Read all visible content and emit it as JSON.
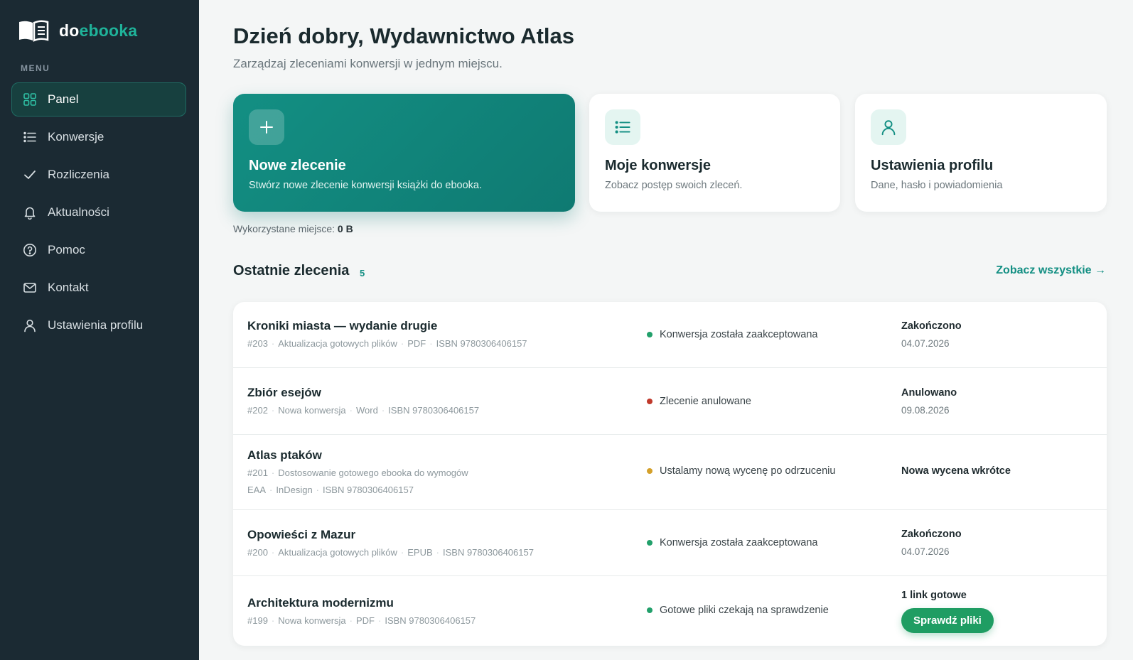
{
  "brand": {
    "name_part1": "do",
    "name_part2": "ebooka"
  },
  "sidebar": {
    "menu_heading": "MENU",
    "items": [
      {
        "label": "Panel",
        "icon": "grid-icon",
        "active": true
      },
      {
        "label": "Konwersje",
        "icon": "list-icon"
      },
      {
        "label": "Rozliczenia",
        "icon": "check-icon"
      },
      {
        "label": "Aktualności",
        "icon": "bell-icon"
      },
      {
        "label": "Pomoc",
        "icon": "help-circle-icon"
      },
      {
        "label": "Kontakt",
        "icon": "mail-icon"
      },
      {
        "label": "Ustawienia profilu",
        "icon": "user-icon"
      }
    ]
  },
  "header": {
    "greeting": "Dzień dobry, Wydawnictwo Atlas",
    "subtitle": "Zarządzaj zleceniami konwersji w jednym miejscu."
  },
  "cards": [
    {
      "title": "Nowe zlecenie",
      "desc": "Stwórz nowe zlecenie konwersji książki do ebooka.",
      "icon": "plus-icon"
    },
    {
      "title": "Moje konwersje",
      "desc": "Zobacz postęp swoich zleceń.",
      "icon": "list-icon"
    },
    {
      "title": "Ustawienia profilu",
      "desc": "Dane, hasło i powiadomienia",
      "icon": "user-icon"
    }
  ],
  "storage": {
    "label": "Wykorzystane miejsce:",
    "value": "0 B"
  },
  "recent": {
    "title": "Ostatnie zlecenia",
    "count": "5",
    "see_all": "Zobacz wszystkie →",
    "orders": [
      {
        "title": "Kroniki miasta — wydanie drugie",
        "id": "#203",
        "type": "Aktualizacja gotowych plików",
        "format": "PDF",
        "isbn": "ISBN 9780306406157",
        "status": "Konwersja została zaakceptowana",
        "status_color": "#22a06b",
        "right_label": "Zakończono",
        "right_date": "04.07.2026"
      },
      {
        "title": "Zbiór esejów",
        "id": "#202",
        "type": "Nowa konwersja",
        "format": "Word",
        "isbn": "ISBN 9780306406157",
        "status": "Zlecenie anulowane",
        "status_color": "#c0392b",
        "right_label": "Anulowano",
        "right_date": "09.08.2026"
      },
      {
        "title": "Atlas ptaków",
        "id": "#201",
        "type": "Dostosowanie gotowego ebooka do wymogów EAA",
        "format": "InDesign",
        "isbn": "ISBN 9780306406157",
        "status": "Ustalamy nową wycenę po odrzuceniu",
        "status_color": "#d4a02a",
        "right_label": "Nowa wycena wkrótce"
      },
      {
        "title": "Opowieści z Mazur",
        "id": "#200",
        "type": "Aktualizacja gotowych plików",
        "format": "EPUB",
        "isbn": "ISBN 9780306406157",
        "status": "Konwersja została zaakceptowana",
        "status_color": "#22a06b",
        "right_label": "Zakończono",
        "right_date": "04.07.2026"
      },
      {
        "title": "Architektura modernizmu",
        "id": "#199",
        "type": "Nowa konwersja",
        "format": "PDF",
        "isbn": "ISBN 9780306406157",
        "status": "Gotowe pliki czekają na sprawdzenie",
        "status_color": "#22a06b",
        "right_label": "1 link gotowe",
        "button": "Sprawdź pliki"
      }
    ]
  },
  "colors": {
    "sidebar_bg": "#1b2a33",
    "accent": "#138f83",
    "button_green": "#1f9d63"
  }
}
